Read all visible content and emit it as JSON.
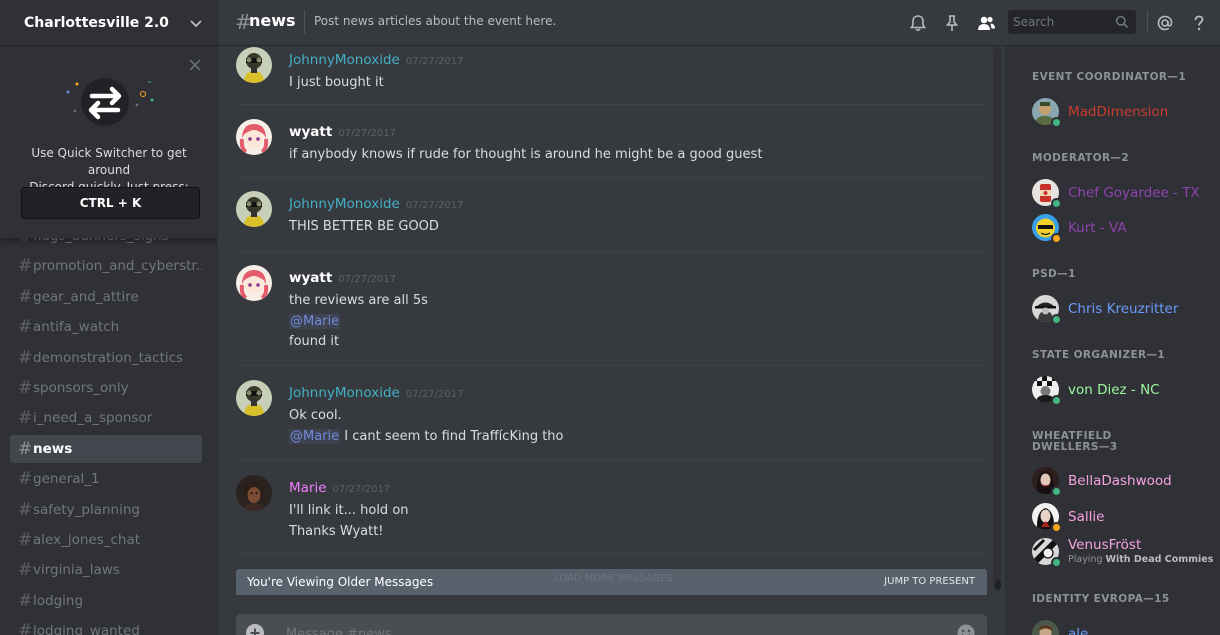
{
  "server": {
    "name": "Charlottesville 2.0"
  },
  "quick_switcher": {
    "text_line1": "Use Quick Switcher to get around",
    "text_line2": "Discord quickly. Just press:",
    "shortcut": "CTRL + K"
  },
  "channels": [
    {
      "name": "flags_banners_signs",
      "active": false
    },
    {
      "name": "promotion_and_cyberstr...",
      "active": false
    },
    {
      "name": "gear_and_attire",
      "active": false
    },
    {
      "name": "antifa_watch",
      "active": false
    },
    {
      "name": "demonstration_tactics",
      "active": false
    },
    {
      "name": "sponsors_only",
      "active": false
    },
    {
      "name": "i_need_a_sponsor",
      "active": false
    },
    {
      "name": "news",
      "active": true
    },
    {
      "name": "general_1",
      "active": false
    },
    {
      "name": "safety_planning",
      "active": false
    },
    {
      "name": "alex_jones_chat",
      "active": false
    },
    {
      "name": "virginia_laws",
      "active": false
    },
    {
      "name": "lodging",
      "active": false
    },
    {
      "name": "lodging_wanted",
      "active": false
    }
  ],
  "channel_header": {
    "hash": "#",
    "name": "news",
    "topic": "Post news articles about the event here.",
    "search_placeholder": "Search"
  },
  "messages": [
    {
      "author": "JohnnyMonoxide",
      "color": "#43b0c4",
      "timestamp": "07/27/2017",
      "avatar": "johnny",
      "lines": [
        [
          {
            "t": "I just bought it"
          }
        ]
      ]
    },
    {
      "author": "wyatt",
      "color": "#ffffff",
      "timestamp": "07/27/2017",
      "avatar": "wyatt",
      "lines": [
        [
          {
            "t": "if anybody knows if rude for thought is around he might be a good guest"
          }
        ]
      ]
    },
    {
      "author": "JohnnyMonoxide",
      "color": "#43b0c4",
      "timestamp": "07/27/2017",
      "avatar": "johnny",
      "lines": [
        [
          {
            "t": "THIS BETTER BE GOOD"
          }
        ]
      ]
    },
    {
      "author": "wyatt",
      "color": "#ffffff",
      "timestamp": "07/27/2017",
      "avatar": "wyatt",
      "lines": [
        [
          {
            "t": "the reviews are all 5s"
          }
        ],
        [
          {
            "t": "@Marie",
            "mention": true
          }
        ],
        [
          {
            "t": "found it"
          }
        ]
      ]
    },
    {
      "author": "JohnnyMonoxide",
      "color": "#43b0c4",
      "timestamp": "07/27/2017",
      "avatar": "johnny",
      "lines": [
        [
          {
            "t": "Ok cool."
          }
        ],
        [
          {
            "t": "@Marie",
            "mention": true
          },
          {
            "t": " I cant seem to find TraffícKing tho"
          }
        ]
      ]
    },
    {
      "author": "Marie",
      "color": "#f47fff",
      "timestamp": "07/27/2017",
      "avatar": "marie",
      "lines": [
        [
          {
            "t": "I'll link it... hold on"
          }
        ],
        [
          {
            "t": "Thanks Wyatt!"
          }
        ]
      ]
    }
  ],
  "older_bar": {
    "label": "You're Viewing Older Messages",
    "load_more": "LOAD MORE MESSAGES",
    "jump": "JUMP TO PRESENT"
  },
  "composer": {
    "placeholder": "Message #news"
  },
  "member_groups": [
    {
      "title": "EVENT COORDINATOR—1",
      "members": [
        {
          "name": "MadDimension",
          "color": "#c93c2e",
          "status": "online",
          "avatar": "mad"
        }
      ]
    },
    {
      "title": "MODERATOR—2",
      "members": [
        {
          "name": "Chef Goyardee - TX",
          "color": "#8e44ad",
          "status": "online",
          "avatar": "chef"
        },
        {
          "name": "Kurt - VA",
          "color": "#8e44ad",
          "status": "idle",
          "avatar": "kurt"
        }
      ]
    },
    {
      "title": "PSD—1",
      "members": [
        {
          "name": "Chris Kreuzritter",
          "color": "#6a9dfa",
          "status": "online",
          "avatar": "chris"
        }
      ]
    },
    {
      "title": "STATE ORGANIZER—1",
      "members": [
        {
          "name": "von Diez - NC",
          "color": "#9df79d",
          "status": "online",
          "avatar": "vondiez"
        }
      ]
    },
    {
      "title": "WHEATFIELD DWELLERS—3",
      "members": [
        {
          "name": "BellaDashwood",
          "color": "#f5a3e0",
          "status": "online",
          "avatar": "bella"
        },
        {
          "name": "Sallie",
          "color": "#f5a3e0",
          "status": "idle",
          "avatar": "sallie"
        },
        {
          "name": "VenusFröst",
          "color": "#f5a3e0",
          "status": "online",
          "avatar": "venus",
          "activity_prefix": "Playing ",
          "activity": "With Dead Commies"
        }
      ]
    },
    {
      "title": "IDENTITY EVROPA—15",
      "members": [
        {
          "name": "ale",
          "color": "#6a9dfa",
          "status": "online",
          "avatar": "ale"
        }
      ]
    }
  ],
  "status_colors": {
    "online": "#43b581",
    "idle": "#faa61a"
  }
}
